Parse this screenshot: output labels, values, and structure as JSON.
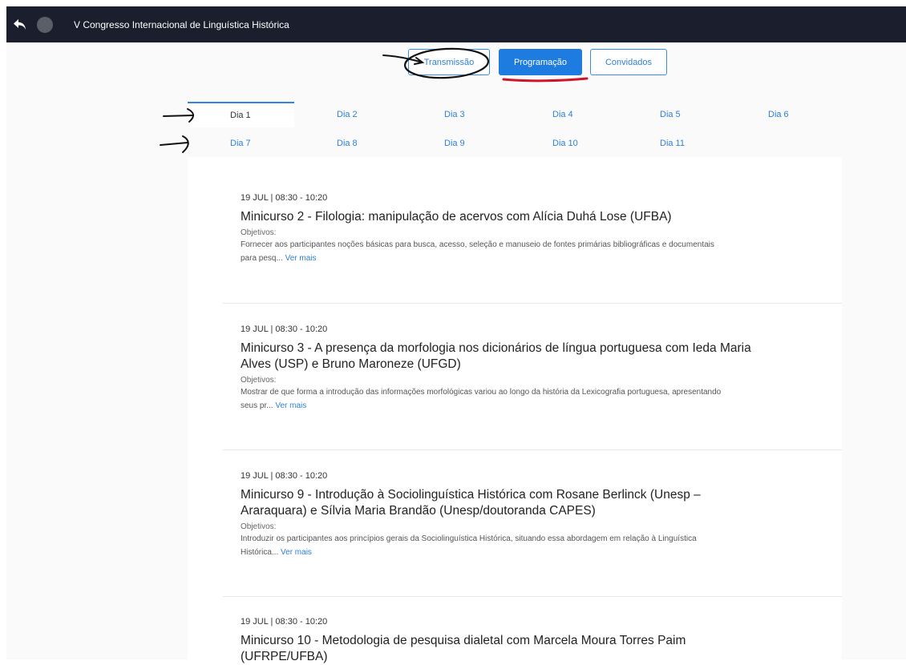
{
  "app": {
    "title": "V Congresso Internacional de Linguística Histórica"
  },
  "nav_buttons": [
    {
      "label": "Transmissão",
      "active": false
    },
    {
      "label": "Programação",
      "active": true
    },
    {
      "label": "Convidados",
      "active": false
    }
  ],
  "day_tabs": [
    "Dia 1",
    "Dia 2",
    "Dia 3",
    "Dia 4",
    "Dia 5",
    "Dia 6",
    "Dia 7",
    "Dia 8",
    "Dia 9",
    "Dia 10",
    "Dia 11"
  ],
  "selected_day": "Dia 1",
  "events": [
    {
      "date": "19 JUL | 08:30 - 10:20",
      "title": "Minicurso 2 - Filologia: manipulação de acervos com Alícia Duhá Lose (UFBA)",
      "objectives_label": "Objetivos:",
      "description": "Fornecer aos participantes noções básicas para busca, acesso, seleção e manuseio de fontes primárias bibliográficas e documentais para pesq...",
      "more_label": "Ver mais"
    },
    {
      "date": "19 JUL | 08:30 - 10:20",
      "title": "Minicurso 3 - A presença da morfologia nos dicionários de língua portuguesa com Ieda Maria Alves (USP) e Bruno Maroneze (UFGD)",
      "objectives_label": "Objetivos:",
      "description": "Mostrar de que forma a introdução das informações morfológicas variou ao longo da história da Lexicografia portuguesa, apresentando seus pr...",
      "more_label": "Ver mais"
    },
    {
      "date": "19 JUL | 08:30 - 10:20",
      "title": "Minicurso 9 - Introdução à Sociolinguística Histórica com Rosane Berlinck (Unesp – Araraquara) e Sílvia Maria Brandão (Unesp/doutoranda CAPES)",
      "objectives_label": "Objetivos:",
      "description": "Introduzir os participantes aos princípios gerais da Sociolinguística Histórica, situando essa abordagem em relação à Linguística Histórica...",
      "more_label": "Ver mais"
    },
    {
      "date": "19 JUL | 08:30 - 10:20",
      "title": "Minicurso 10 - Metodologia de pesquisa dialetal com Marcela Moura Torres Paim (UFRPE/UFBA)",
      "objectives_label": "",
      "description": "",
      "more_label": ""
    }
  ],
  "colors": {
    "topbar": "#1b1f2d",
    "accent": "#1e7be0",
    "link": "#2f7fd6",
    "annotation_red": "#d0142a"
  }
}
